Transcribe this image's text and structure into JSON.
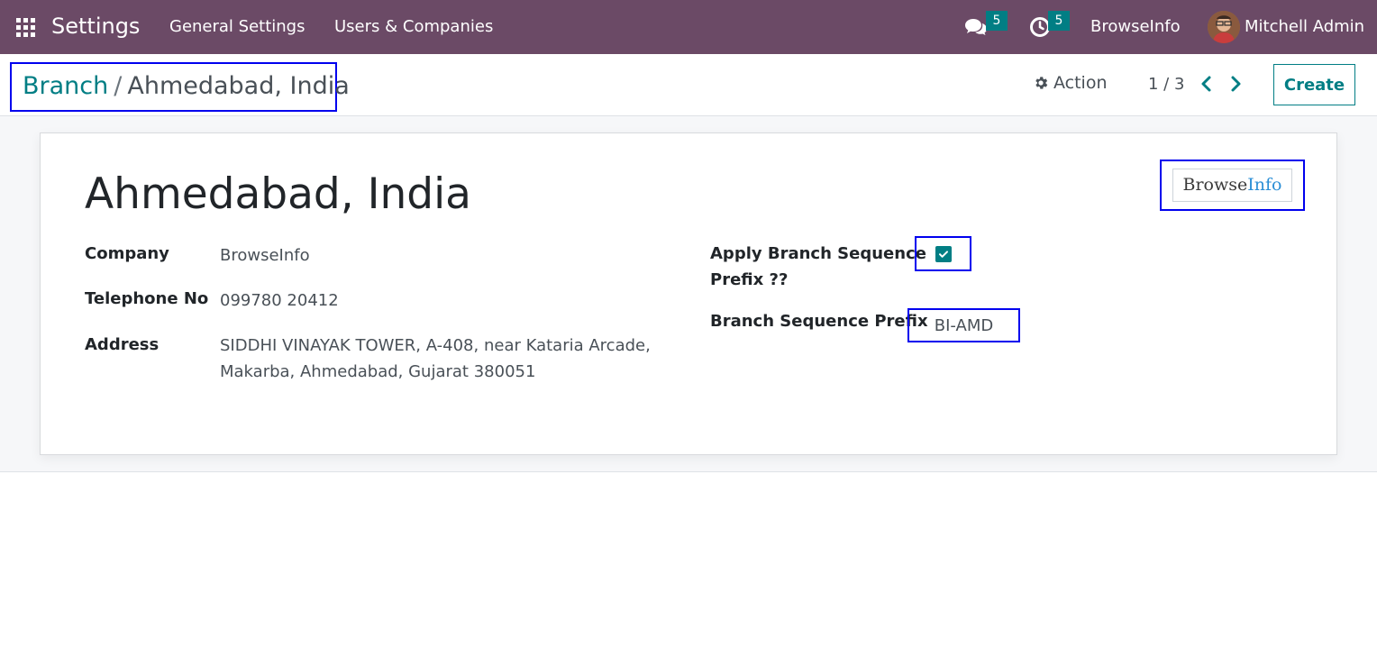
{
  "navbar": {
    "app_title": "Settings",
    "menu": [
      "General Settings",
      "Users & Companies"
    ],
    "messages_count": "5",
    "activities_count": "5",
    "company": "BrowseInfo",
    "user": "Mitchell Admin",
    "bg_color": "#6b4a66"
  },
  "control_panel": {
    "breadcrumb_parent": "Branch",
    "breadcrumb_sep": "/",
    "breadcrumb_current": "Ahmedabad, India",
    "action_label": "Action",
    "pager": "1 / 3",
    "create_label": "Create"
  },
  "form": {
    "title": "Ahmedabad, India",
    "left_fields": [
      {
        "label": "Company",
        "value": "BrowseInfo"
      },
      {
        "label": "Telephone No",
        "value": "099780 20412"
      },
      {
        "label": "Address",
        "value_line1": "SIDDHI VINAYAK TOWER, A-408, near Kataria Arcade,",
        "value_line2": "Makarba, Ahmedabad, Gujarat 380051"
      }
    ],
    "right_fields": {
      "apply_prefix_label_line1": "Apply Branch Sequence",
      "apply_prefix_label_line2": "Prefix ??",
      "apply_prefix_checked": true,
      "prefix_label": "Branch Sequence Prefix",
      "prefix_value": "BI-AMD"
    },
    "logo": {
      "part1": "Browse",
      "part2": "Info"
    }
  },
  "colors": {
    "accent": "#017e84",
    "highlight_box": "#0000ee"
  }
}
